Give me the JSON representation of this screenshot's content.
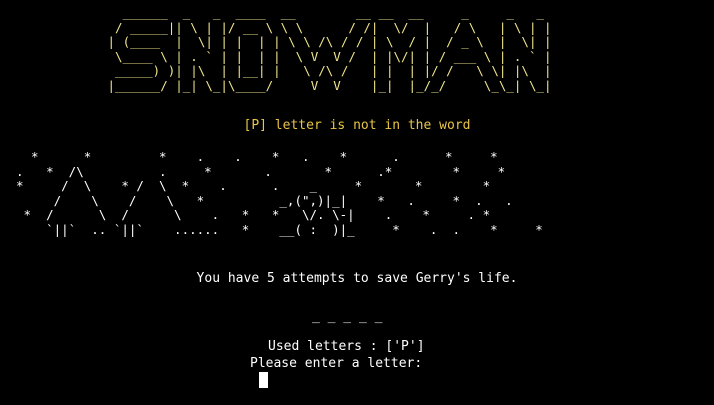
{
  "banner": {
    "ascii_logo": "   ______  _   _  ____  __        __ __  __     _     _   _ \n  / _____|| \\ | |/ __ \\ \\ \\      / /|  \\/  |   / \\   | \\ | |\n | (____  |  \\| | |  | | \\ \\ /\\ / / | \\  / |  / _ \\  |  \\| |\n  \\____ \\ | . ` | |  | |  \\ V  V /  | |\\/| | / ___ \\ | . ` |\n  _____) )| |\\  | |__| |   \\ /\\ /   | |  | |/ /   \\ \\| |\\  |\n |______/ |_| \\_|\\____/     V  V    |_|  |_/_/     \\_\\_| \\_|",
    "logo_text": "SNOWMAN"
  },
  "status": {
    "message": "[P] letter is not in the word"
  },
  "scene": {
    "ascii_art": "  *      *         *    .    .    *   .    *      .      *     *\n.   *  /\\          .     *       .       *      .*        *     *\n*     /  \\    * /  \\  *    .      .    _     *       *        *\n     /    \\    /    \\   *          _,(\",)|_|    *   .     *  .   .\n *  /      \\  /      \\    .   *   *   \\/. \\-|    .    *     . *\n    `||`  .. `||`    ......   *    __( :  )|_     *    .  .    *     *"
  },
  "game": {
    "attempts_message": "You have 5 attempts to save Gerry's life.",
    "word_display": "_ _ _ _ _",
    "used_letters_label": "Used letters : ['P']",
    "prompt": "Please enter a letter:"
  },
  "colors": {
    "background": "#000000",
    "logo": "#f0e68c",
    "status": "#e8c547",
    "text": "#ffffff"
  }
}
